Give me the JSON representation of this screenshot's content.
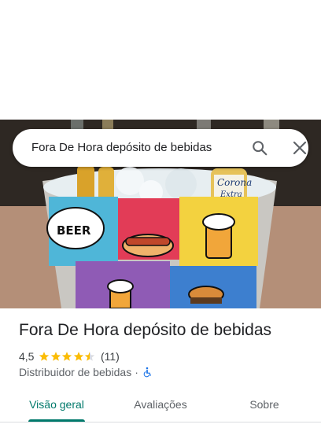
{
  "search": {
    "query": "Fora De Hora depósito de bebidas"
  },
  "place": {
    "title": "Fora De Hora depósito de bebidas",
    "rating": "4,5",
    "rating_fraction": 0.9,
    "review_count": "(11)",
    "category": "Distribuidor de bebidas",
    "separator": "·",
    "accessibility_icon": "wheelchair-icon"
  },
  "photo": {
    "bucket_text_1": "BEER",
    "bucket_text_2": "Corona",
    "bucket_text_3": "Extra"
  },
  "tabs": [
    {
      "label": "Visão geral",
      "active": true
    },
    {
      "label": "Avaliações",
      "active": false
    },
    {
      "label": "Sobre",
      "active": false
    }
  ],
  "colors": {
    "accent": "#00796b",
    "star": "#fbbc04",
    "accessibility": "#1a73e8"
  }
}
